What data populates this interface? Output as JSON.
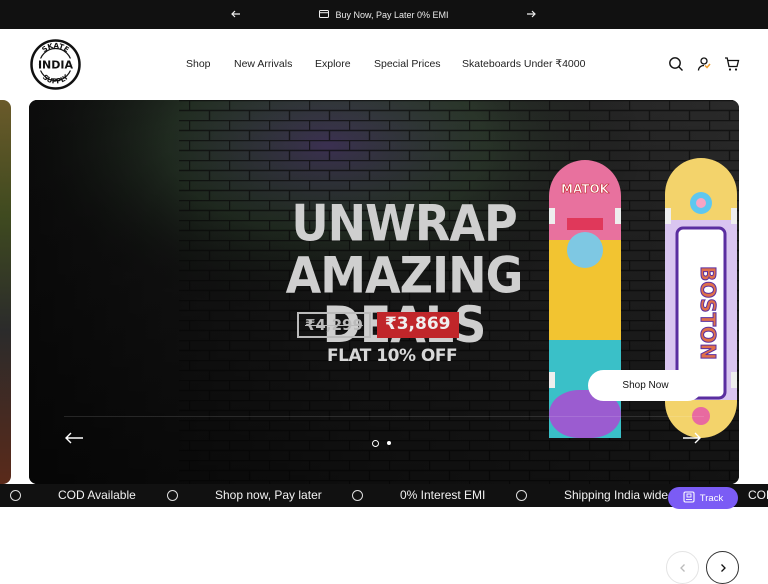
{
  "announcement": {
    "text": "Buy Now, Pay Later 0% EMI",
    "icon": "card-icon"
  },
  "brand": {
    "logo_top": "SKATE",
    "logo_middle": "INDIA",
    "logo_bottom": "SUPPLY"
  },
  "nav": {
    "items": [
      "Shop",
      "New Arrivals",
      "Explore",
      "Special Prices",
      "Skateboards Under ₹4000"
    ]
  },
  "header_icons": [
    "search-icon",
    "account-icon",
    "cart-icon"
  ],
  "hero": {
    "headline_line1": "UNWRAP",
    "headline_line2": "AMAZING DEALS",
    "old_price": "₹4,299",
    "new_price": "₹3,869",
    "discount": "FLAT 10% OFF",
    "cta": "Shop Now",
    "deck_left_text": "MATOK",
    "deck_right_text": "BOSTON",
    "slides_total": 2,
    "active_slide": 1
  },
  "ticker": {
    "items": [
      "COD Available",
      "Shop now, Pay later",
      "0% Interest EMI",
      "Shipping India wide",
      "COD"
    ]
  },
  "track": {
    "label": "Track"
  },
  "colors": {
    "announcement_bg": "#111111",
    "price_red": "#c0262a",
    "track_purple": "#7b5cf5",
    "account_accent": "#f0a030"
  }
}
